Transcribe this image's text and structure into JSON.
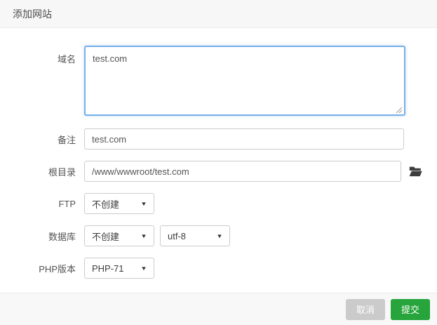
{
  "dialog": {
    "title": "添加网站",
    "fields": {
      "domain": {
        "label": "域名",
        "value": "test.com"
      },
      "remark": {
        "label": "备注",
        "value": "test.com"
      },
      "root_dir": {
        "label": "根目录",
        "value": "/www/wwwroot/test.com"
      },
      "ftp": {
        "label": "FTP",
        "selected": "不创建"
      },
      "database": {
        "label": "数据库",
        "selected": "不创建",
        "charset": "utf-8"
      },
      "php": {
        "label": "PHP版本",
        "selected": "PHP-71"
      }
    },
    "footer": {
      "cancel_label": "取消",
      "submit_label": "提交"
    },
    "colors": {
      "accent_green": "#27a43b",
      "cancel_gray": "#cbcbcb",
      "focus_blue": "#77aee9"
    }
  },
  "icons": {
    "chevron_down": "▼"
  }
}
